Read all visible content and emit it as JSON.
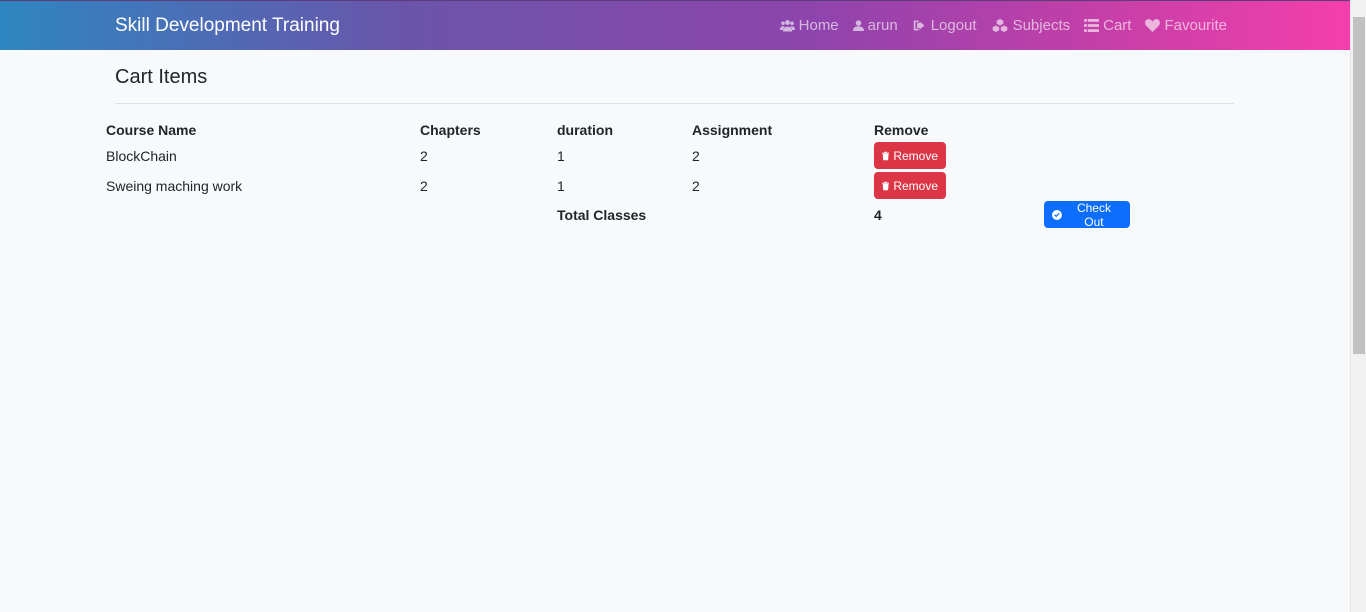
{
  "navbar": {
    "brand": "Skill Development Training",
    "links": [
      {
        "label": "Home",
        "icon": "users-icon"
      },
      {
        "label": "arun",
        "icon": "user-icon"
      },
      {
        "label": "Logout",
        "icon": "sign-out-icon"
      },
      {
        "label": "Subjects",
        "icon": "cubes-icon"
      },
      {
        "label": "Cart",
        "icon": "list-icon"
      },
      {
        "label": "Favourite",
        "icon": "heart-icon"
      }
    ]
  },
  "page": {
    "title": "Cart Items"
  },
  "table": {
    "headers": [
      "Course Name",
      "Chapters",
      "duration",
      "Assignment",
      "Remove"
    ],
    "rows": [
      {
        "course": "BlockChain",
        "chapters": "2",
        "duration": "1",
        "assignment": "2",
        "remove_label": "Remove"
      },
      {
        "course": "Sweing maching work",
        "chapters": "2",
        "duration": "1",
        "assignment": "2",
        "remove_label": "Remove"
      }
    ],
    "total_label": "Total Classes",
    "total_value": "4",
    "checkout_label": "Check Out"
  },
  "colors": {
    "danger": "#dc3545",
    "primary": "#0d6efd",
    "navbar_start": "#2e86c1",
    "navbar_end": "#f43fac"
  }
}
